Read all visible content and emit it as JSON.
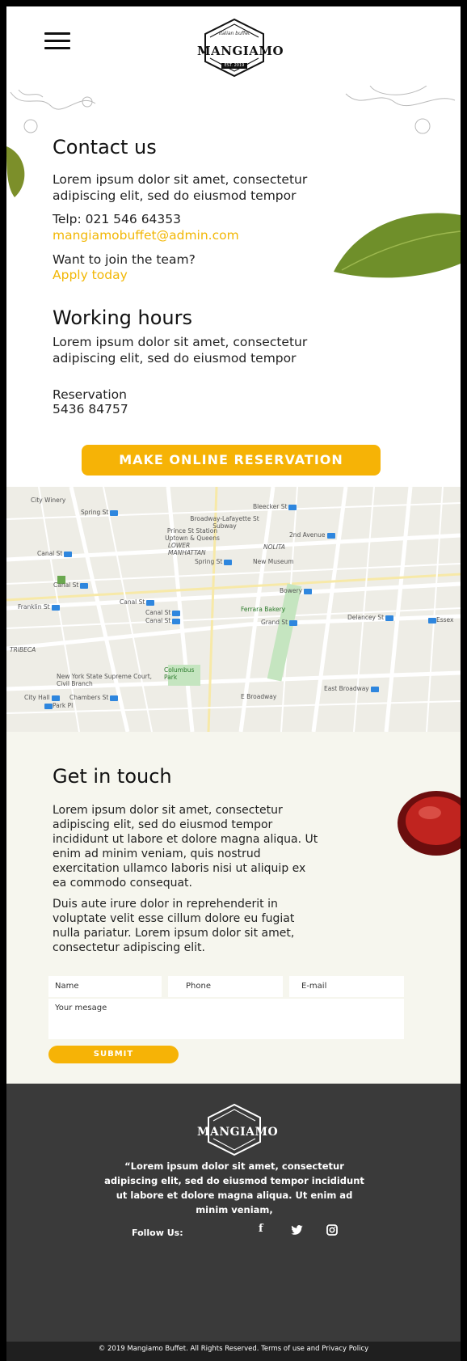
{
  "header": {
    "logo_text": "MANGIAMO",
    "logo_subtext": "Italian buffet",
    "logo_est": "EST. 2019"
  },
  "contact": {
    "title": "Contact us",
    "intro_line1": "Lorem ipsum dolor sit amet, consectetur",
    "intro_line2": "adipiscing elit, sed do eiusmod tempor",
    "phone": "Telp: 021 546 64353",
    "email": "mangiamobuffet@admin.com",
    "join_question": "Want to join the team?",
    "join_link": "Apply today"
  },
  "working_hours": {
    "title": "Working hours",
    "text_line1": "Lorem ipsum dolor sit amet, consectetur",
    "text_line2": "adipiscing elit, sed do eiusmod tempor",
    "reservation_label": "Reservation",
    "reservation_number": "5436 84757",
    "reserve_button": "MAKE ONLINE RESERVATION"
  },
  "map": {
    "labels": {
      "city_winery": "City Winery",
      "spring_st_1": "Spring St",
      "bleecker": "Bleecker St",
      "broadway_lafayette": "Broadway-Lafayette St Subway",
      "prince_st": "Prince St Station Uptown & Queens",
      "second_ave": "2nd Avenue",
      "lower_manhattan": "LOWER MANHATTAN",
      "nolita": "NOLITA",
      "spring_st_2": "Spring St",
      "new_museum": "New Museum",
      "canal_st_1": "Canal St",
      "canal_st_2": "Canal St",
      "bowery": "Bowery",
      "franklin": "Franklin St",
      "canal_st_3": "Canal St",
      "canal_st_4": "Canal St",
      "canal_st_5": "Canal St",
      "ferrara": "Ferrara Bakery",
      "grand_st": "Grand St",
      "delancey": "Delancey St",
      "essex": "Essex",
      "tribeca": "TRIBECA",
      "columbus_park": "Columbus Park",
      "ny_court": "New York State Supreme Court, Civil Branch",
      "east_broadway": "East Broadway",
      "city_hall": "City Hall",
      "chambers": "Chambers St",
      "park_pl": "Park Pl",
      "e_broadway": "E Broadway"
    }
  },
  "touch": {
    "title": "Get in touch",
    "para1_lines": [
      "Lorem ipsum dolor sit amet, consectetur",
      "adipiscing elit, sed do eiusmod tempor",
      "incididunt ut labore et dolore magna aliqua. Ut",
      "enim ad minim veniam, quis nostrud",
      "exercitation ullamco laboris nisi ut aliquip ex",
      "ea commodo consequat."
    ],
    "para2_lines": [
      "Duis aute irure dolor in reprehenderit in",
      "voluptate velit esse cillum dolore eu fugiat",
      "nulla pariatur. Lorem ipsum dolor sit amet,",
      "consectetur adipiscing elit."
    ],
    "name_placeholder": "Name",
    "phone_placeholder": "Phone",
    "email_placeholder": "E-mail",
    "message_placeholder": "Your mesage",
    "submit_label": "SUBMIT"
  },
  "footer": {
    "logo_text": "MANGIAMO",
    "quote_lines": [
      "“Lorem ipsum dolor sit amet, consectetur",
      "adipiscing elit, sed do eiusmod tempor incididunt",
      "ut labore et dolore magna aliqua. Ut enim ad",
      "minim veniam,"
    ],
    "follow_label": "Follow Us:",
    "social_icons": [
      "facebook-icon",
      "twitter-icon",
      "instagram-icon"
    ],
    "facebook_glyph": "f",
    "copyright": "© 2019 Mangiamo Buffet. All Rights Reserved. Terms of use and Privacy Policy"
  },
  "colors": {
    "accent": "#f6b306",
    "footer_bg": "#3a3a3a",
    "touch_bg": "#f6f6ee"
  }
}
